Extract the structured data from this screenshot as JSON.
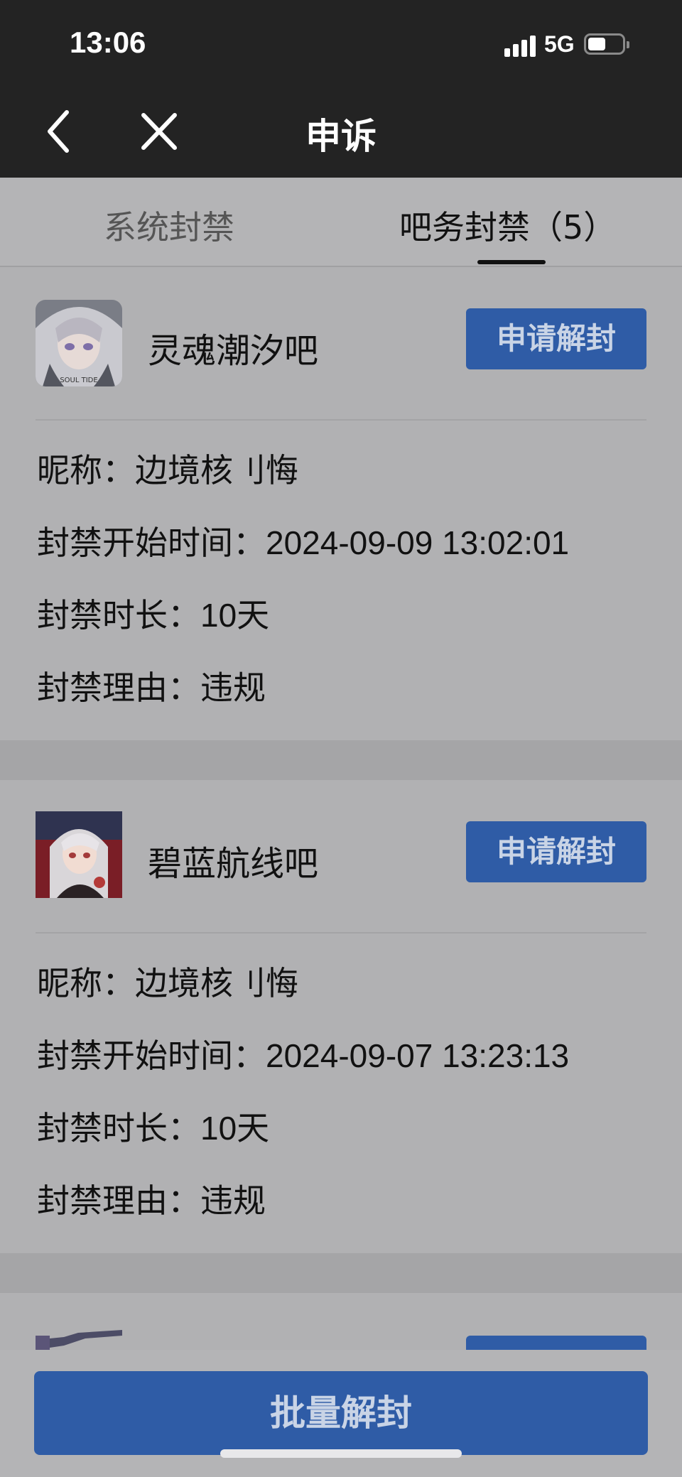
{
  "status_bar": {
    "time": "13:06",
    "network": "5G"
  },
  "nav": {
    "title": "申诉"
  },
  "tabs": [
    {
      "label": "系统封禁"
    },
    {
      "label": "吧务封禁（5）"
    }
  ],
  "labels": {
    "nickname": "昵称：",
    "start_time": "封禁开始时间：",
    "duration": "封禁时长：",
    "reason": "封禁理由："
  },
  "cards": [
    {
      "forum": "灵魂潮汐吧",
      "button": "申请解封",
      "nickname": "边境核刂悔",
      "start_time": "2024-09-09 13:02:01",
      "duration": "10天",
      "reason": "违规",
      "avatar_text": "SOUL TIDE"
    },
    {
      "forum": "碧蓝航线吧",
      "button": "申请解封",
      "nickname": "边境核刂悔",
      "start_time": "2024-09-07 13:23:13",
      "duration": "10天",
      "reason": "违规"
    }
  ],
  "bulk_button": "批量解封",
  "colors": {
    "accent": "#2f5ca6",
    "header_bg": "#232323",
    "page_bg": "#b4b4b6"
  }
}
